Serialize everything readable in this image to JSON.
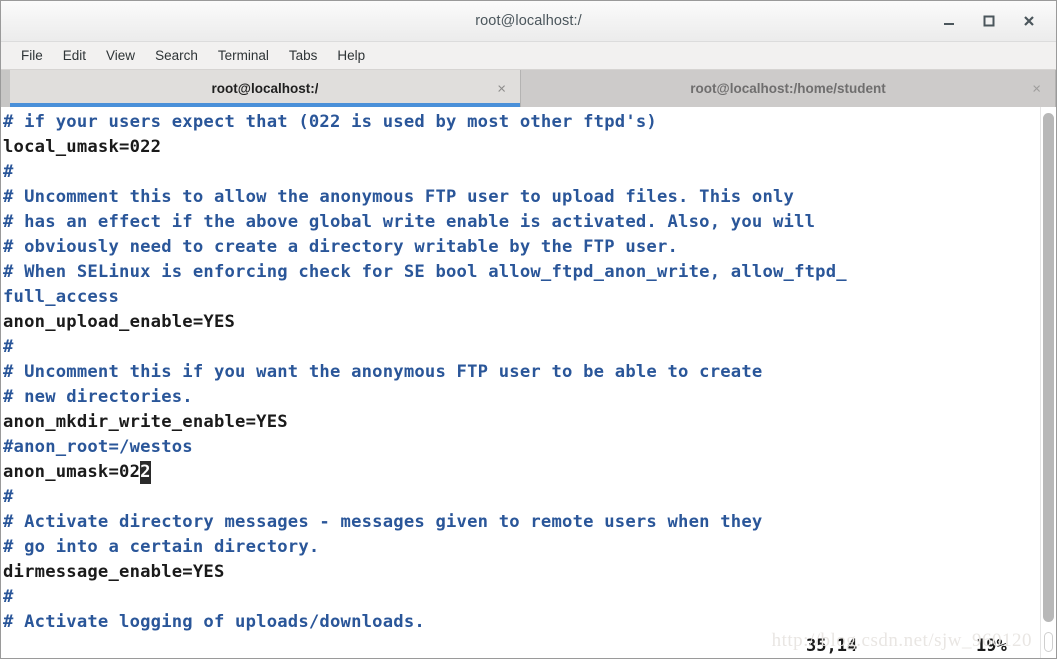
{
  "window": {
    "title": "root@localhost:/",
    "controls": [
      {
        "name": "minimize-button",
        "label": "_"
      },
      {
        "name": "maximize-button",
        "label": "□"
      },
      {
        "name": "close-button",
        "label": "✕"
      }
    ]
  },
  "menubar": {
    "items": [
      {
        "label": "File"
      },
      {
        "label": "Edit"
      },
      {
        "label": "View"
      },
      {
        "label": "Search"
      },
      {
        "label": "Terminal"
      },
      {
        "label": "Tabs"
      },
      {
        "label": "Help"
      }
    ]
  },
  "tabs": [
    {
      "label": "root@localhost:/",
      "active": true,
      "close_label": "×"
    },
    {
      "label": "root@localhost:/home/student",
      "active": false,
      "close_label": "×"
    }
  ],
  "terminal": {
    "colors": {
      "comment": "#2a5699",
      "code": "#1a1a1a",
      "background": "#ffffff",
      "cursor_bg": "#2b2b2b",
      "cursor_fg": "#ffffff",
      "tab_accent": "#4a90d9"
    },
    "lines": [
      {
        "text": "# if your users expect that (022 is used by most other ftpd's)",
        "kind": "comment"
      },
      {
        "text": "local_umask=022",
        "kind": "code"
      },
      {
        "text": "#",
        "kind": "comment"
      },
      {
        "text": "# Uncomment this to allow the anonymous FTP user to upload files. This only",
        "kind": "comment"
      },
      {
        "text": "# has an effect if the above global write enable is activated. Also, you will",
        "kind": "comment"
      },
      {
        "text": "# obviously need to create a directory writable by the FTP user.",
        "kind": "comment"
      },
      {
        "text": "# When SELinux is enforcing check for SE bool allow_ftpd_anon_write, allow_ftpd_",
        "kind": "comment"
      },
      {
        "text": "full_access",
        "kind": "comment"
      },
      {
        "text": "anon_upload_enable=YES",
        "kind": "code"
      },
      {
        "text": "#",
        "kind": "comment"
      },
      {
        "text": "# Uncomment this if you want the anonymous FTP user to be able to create",
        "kind": "comment"
      },
      {
        "text": "# new directories.",
        "kind": "comment"
      },
      {
        "text": "anon_mkdir_write_enable=YES",
        "kind": "code"
      },
      {
        "text": "#anon_root=/westos",
        "kind": "comment"
      },
      {
        "text": "anon_umask=022",
        "kind": "code",
        "cursor_at": 13
      },
      {
        "text": "#",
        "kind": "comment"
      },
      {
        "text": "# Activate directory messages - messages given to remote users when they",
        "kind": "comment"
      },
      {
        "text": "# go into a certain directory.",
        "kind": "comment"
      },
      {
        "text": "dirmessage_enable=YES",
        "kind": "code"
      },
      {
        "text": "#",
        "kind": "comment"
      },
      {
        "text": "# Activate logging of uploads/downloads.",
        "kind": "comment"
      }
    ],
    "status": {
      "position": "35,14",
      "percent": "19%"
    },
    "watermark": "http://blog.csdn.net/sjw_960120"
  }
}
